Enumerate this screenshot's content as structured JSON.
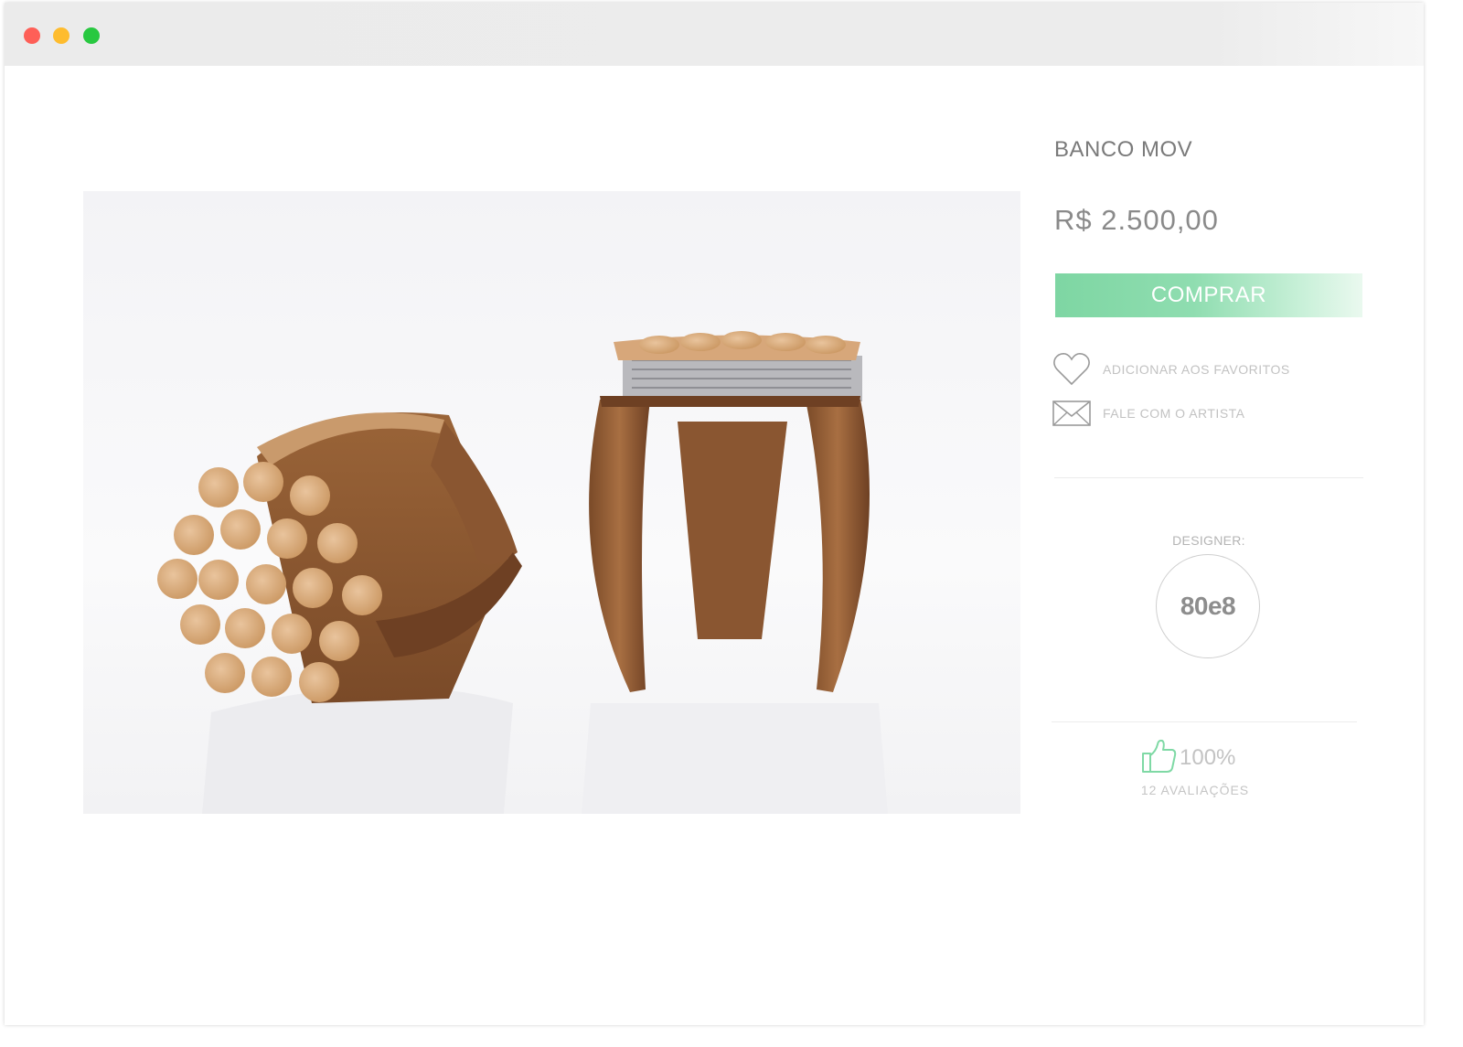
{
  "window": {
    "controls": [
      "close",
      "minimize",
      "maximize"
    ]
  },
  "product": {
    "title": "BANCO MOV",
    "price": "R$ 2.500,00",
    "image_alt": "product-photo",
    "buy_label": "COMPRAR",
    "accent": "#7ed6a3"
  },
  "actions": {
    "favorite_label": "ADICIONAR AOS FAVORITOS",
    "favorite_icon": "heart-icon",
    "contact_label": "FALE COM O ARTISTA",
    "contact_icon": "envelope-icon"
  },
  "designer": {
    "label": "DESIGNER:",
    "name": "80e8"
  },
  "rating": {
    "icon": "thumbs-up-icon",
    "percent": "100%",
    "reviews": "12 AVALIAÇÕES"
  }
}
